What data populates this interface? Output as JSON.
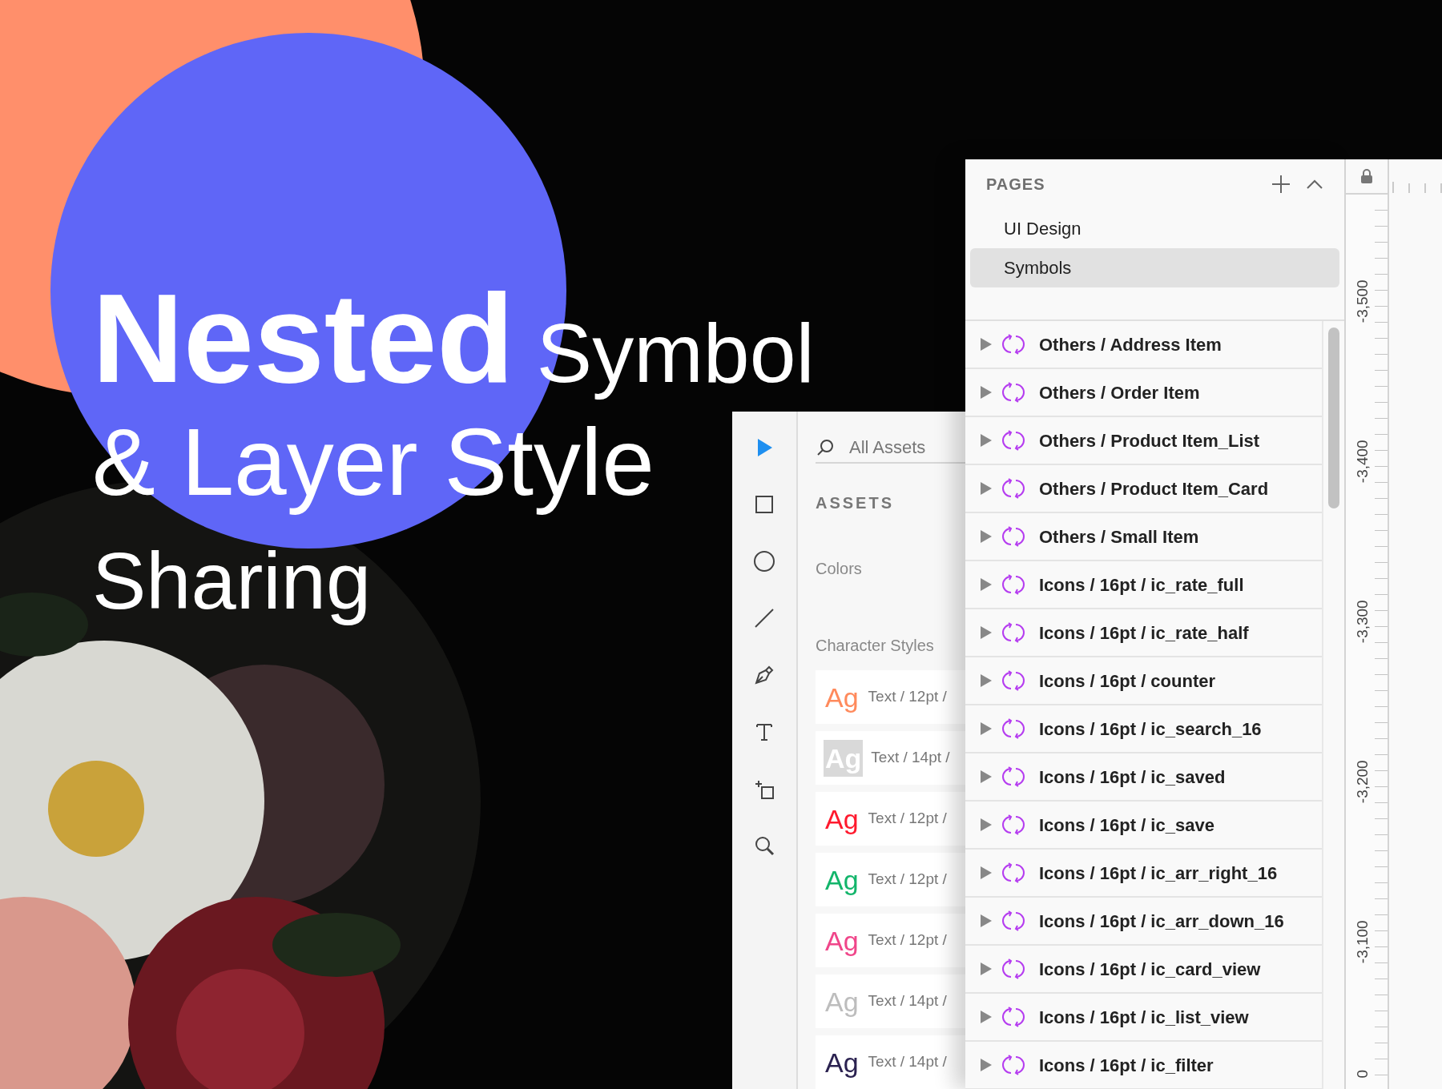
{
  "headline": {
    "line_1_bold": "Nested",
    "line_1_light": "Symbol",
    "line_2": "& Layer Style",
    "line_3": "Sharing"
  },
  "tools": [
    {
      "kind": "select",
      "selected": true
    },
    {
      "kind": "rectangle",
      "selected": false
    },
    {
      "kind": "ellipse",
      "selected": false
    },
    {
      "kind": "line",
      "selected": false
    },
    {
      "kind": "pen",
      "selected": false
    },
    {
      "kind": "text",
      "selected": false
    },
    {
      "kind": "artboard",
      "selected": false
    },
    {
      "kind": "zoom",
      "selected": false
    }
  ],
  "assets_panel": {
    "search": {
      "placeholder": "All Assets"
    },
    "title": "ASSETS",
    "colors_label": "Colors",
    "character_styles_label": "Character Styles",
    "character_styles": [
      {
        "kind": "plain",
        "sample": "Ag",
        "name": "Text / 12pt /",
        "color": "#ff8a5c"
      },
      {
        "kind": "swatch",
        "sample": "Ag",
        "name": "Text / 14pt /",
        "color": "#ffffff"
      },
      {
        "kind": "plain",
        "sample": "Ag",
        "name": "Text / 12pt /",
        "color": "#ff1a2e"
      },
      {
        "kind": "plain",
        "sample": "Ag",
        "name": "Text / 12pt /",
        "color": "#13b56b"
      },
      {
        "kind": "plain",
        "sample": "Ag",
        "name": "Text / 12pt /",
        "color": "#f0468a"
      },
      {
        "kind": "plain",
        "sample": "Ag",
        "name": "Text / 14pt /",
        "color": "#bdbdbd"
      },
      {
        "kind": "plain",
        "sample": "Ag",
        "name": "Text / 14pt /",
        "color": "#2b2250"
      }
    ]
  },
  "pages_panel": {
    "title": "PAGES",
    "pages": [
      {
        "name": "UI Design",
        "selected": false
      },
      {
        "name": "Symbols",
        "selected": true
      }
    ]
  },
  "symbols": [
    {
      "name": "Others / Address Item",
      "expanded": false
    },
    {
      "name": "Others / Order Item",
      "expanded": false
    },
    {
      "name": "Others / Product Item_List",
      "expanded": false
    },
    {
      "name": "Others / Product Item_Card",
      "expanded": false
    },
    {
      "name": "Others / Small Item",
      "expanded": false
    },
    {
      "name": "Icons / 16pt / ic_rate_full",
      "expanded": false
    },
    {
      "name": "Icons / 16pt / ic_rate_half",
      "expanded": false
    },
    {
      "name": "Icons / 16pt / counter",
      "expanded": false
    },
    {
      "name": "Icons / 16pt / ic_search_16",
      "expanded": false
    },
    {
      "name": "Icons / 16pt / ic_saved",
      "expanded": false
    },
    {
      "name": "Icons / 16pt / ic_save",
      "expanded": false
    },
    {
      "name": "Icons / 16pt / ic_arr_right_16",
      "expanded": false
    },
    {
      "name": "Icons / 16pt / ic_arr_down_16",
      "expanded": false
    },
    {
      "name": "Icons / 16pt / ic_card_view",
      "expanded": false
    },
    {
      "name": "Icons / 16pt / ic_list_view",
      "expanded": false
    },
    {
      "name": "Icons / 16pt / ic_filter",
      "expanded": false
    }
  ],
  "ruler": {
    "labels": [
      "-3,500",
      "-3,400",
      "-3,300",
      "-3,200",
      "-3,100",
      "0"
    ]
  }
}
